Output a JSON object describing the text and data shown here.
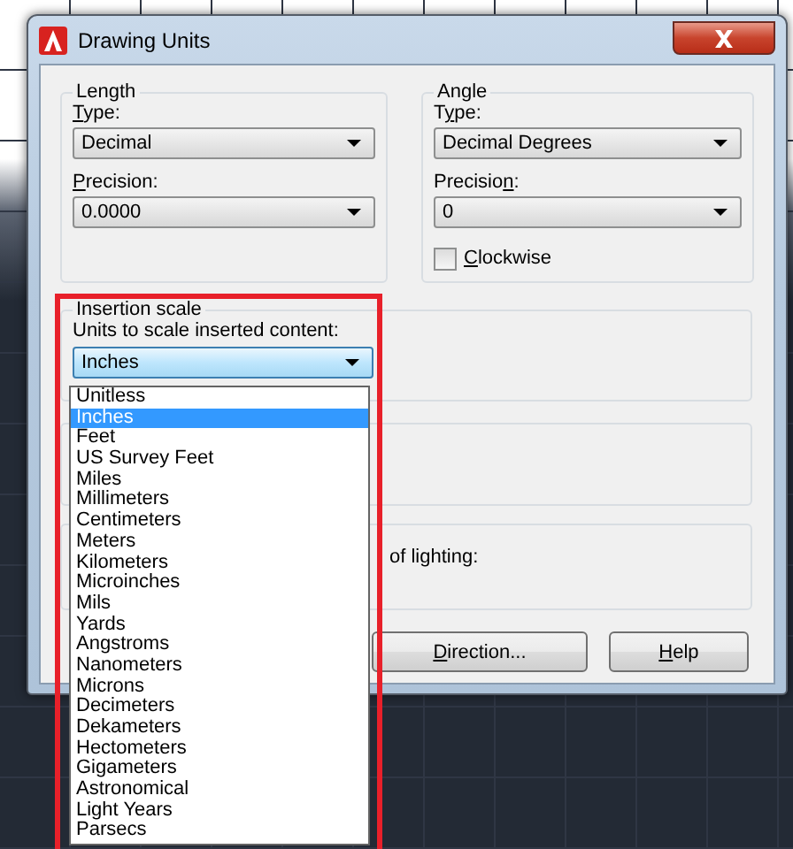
{
  "window": {
    "title": "Drawing Units"
  },
  "length": {
    "title": "Length",
    "type_label": [
      {
        "text": "T",
        "underlined": true
      },
      {
        "text": "ype:",
        "underlined": false
      }
    ],
    "type": "Decimal",
    "precision_label": [
      {
        "text": "P",
        "underlined": true
      },
      {
        "text": "recision:",
        "underlined": false
      }
    ],
    "precision": "0.0000"
  },
  "angle": {
    "title": "Angle",
    "type_label": [
      {
        "text": "T",
        "underlined": false
      },
      {
        "text": "y",
        "underlined": true
      },
      {
        "text": "pe:",
        "underlined": false
      }
    ],
    "type": "Decimal Degrees",
    "precision_label": [
      {
        "text": "Precisio",
        "underlined": false
      },
      {
        "text": "n",
        "underlined": true
      },
      {
        "text": ":",
        "underlined": false
      }
    ],
    "precision": "0",
    "clockwise": {
      "label": [
        {
          "text": "C",
          "underlined": true
        },
        {
          "text": "lockwise",
          "underlined": false
        }
      ],
      "checked": false
    }
  },
  "insertion_scale": {
    "title": "Insertion scale",
    "label": "Units to scale inserted content:",
    "value": "Inches",
    "options": [
      {
        "label": "Unitless",
        "selected": false
      },
      {
        "label": "Inches",
        "selected": true
      },
      {
        "label": "Feet",
        "selected": false
      },
      {
        "label": "US Survey Feet",
        "selected": false
      },
      {
        "label": "Miles",
        "selected": false
      },
      {
        "label": "Millimeters",
        "selected": false
      },
      {
        "label": "Centimeters",
        "selected": false
      },
      {
        "label": "Meters",
        "selected": false
      },
      {
        "label": "Kilometers",
        "selected": false
      },
      {
        "label": "Microinches",
        "selected": false
      },
      {
        "label": "Mils",
        "selected": false
      },
      {
        "label": "Yards",
        "selected": false
      },
      {
        "label": "Angstroms",
        "selected": false
      },
      {
        "label": "Nanometers",
        "selected": false
      },
      {
        "label": "Microns",
        "selected": false
      },
      {
        "label": "Decimeters",
        "selected": false
      },
      {
        "label": "Dekameters",
        "selected": false
      },
      {
        "label": "Hectometers",
        "selected": false
      },
      {
        "label": "Gigameters",
        "selected": false
      },
      {
        "label": "Astronomical",
        "selected": false
      },
      {
        "label": "Light Years",
        "selected": false
      },
      {
        "label": "Parsecs",
        "selected": false
      }
    ]
  },
  "lighting": {
    "label": "of lighting:"
  },
  "buttons": [
    {
      "label": [
        {
          "text": "D",
          "underlined": true
        },
        {
          "text": "irection...",
          "underlined": false
        }
      ]
    },
    {
      "label": [
        {
          "text": "H",
          "underlined": true
        },
        {
          "text": "elp",
          "underlined": false
        }
      ]
    }
  ]
}
